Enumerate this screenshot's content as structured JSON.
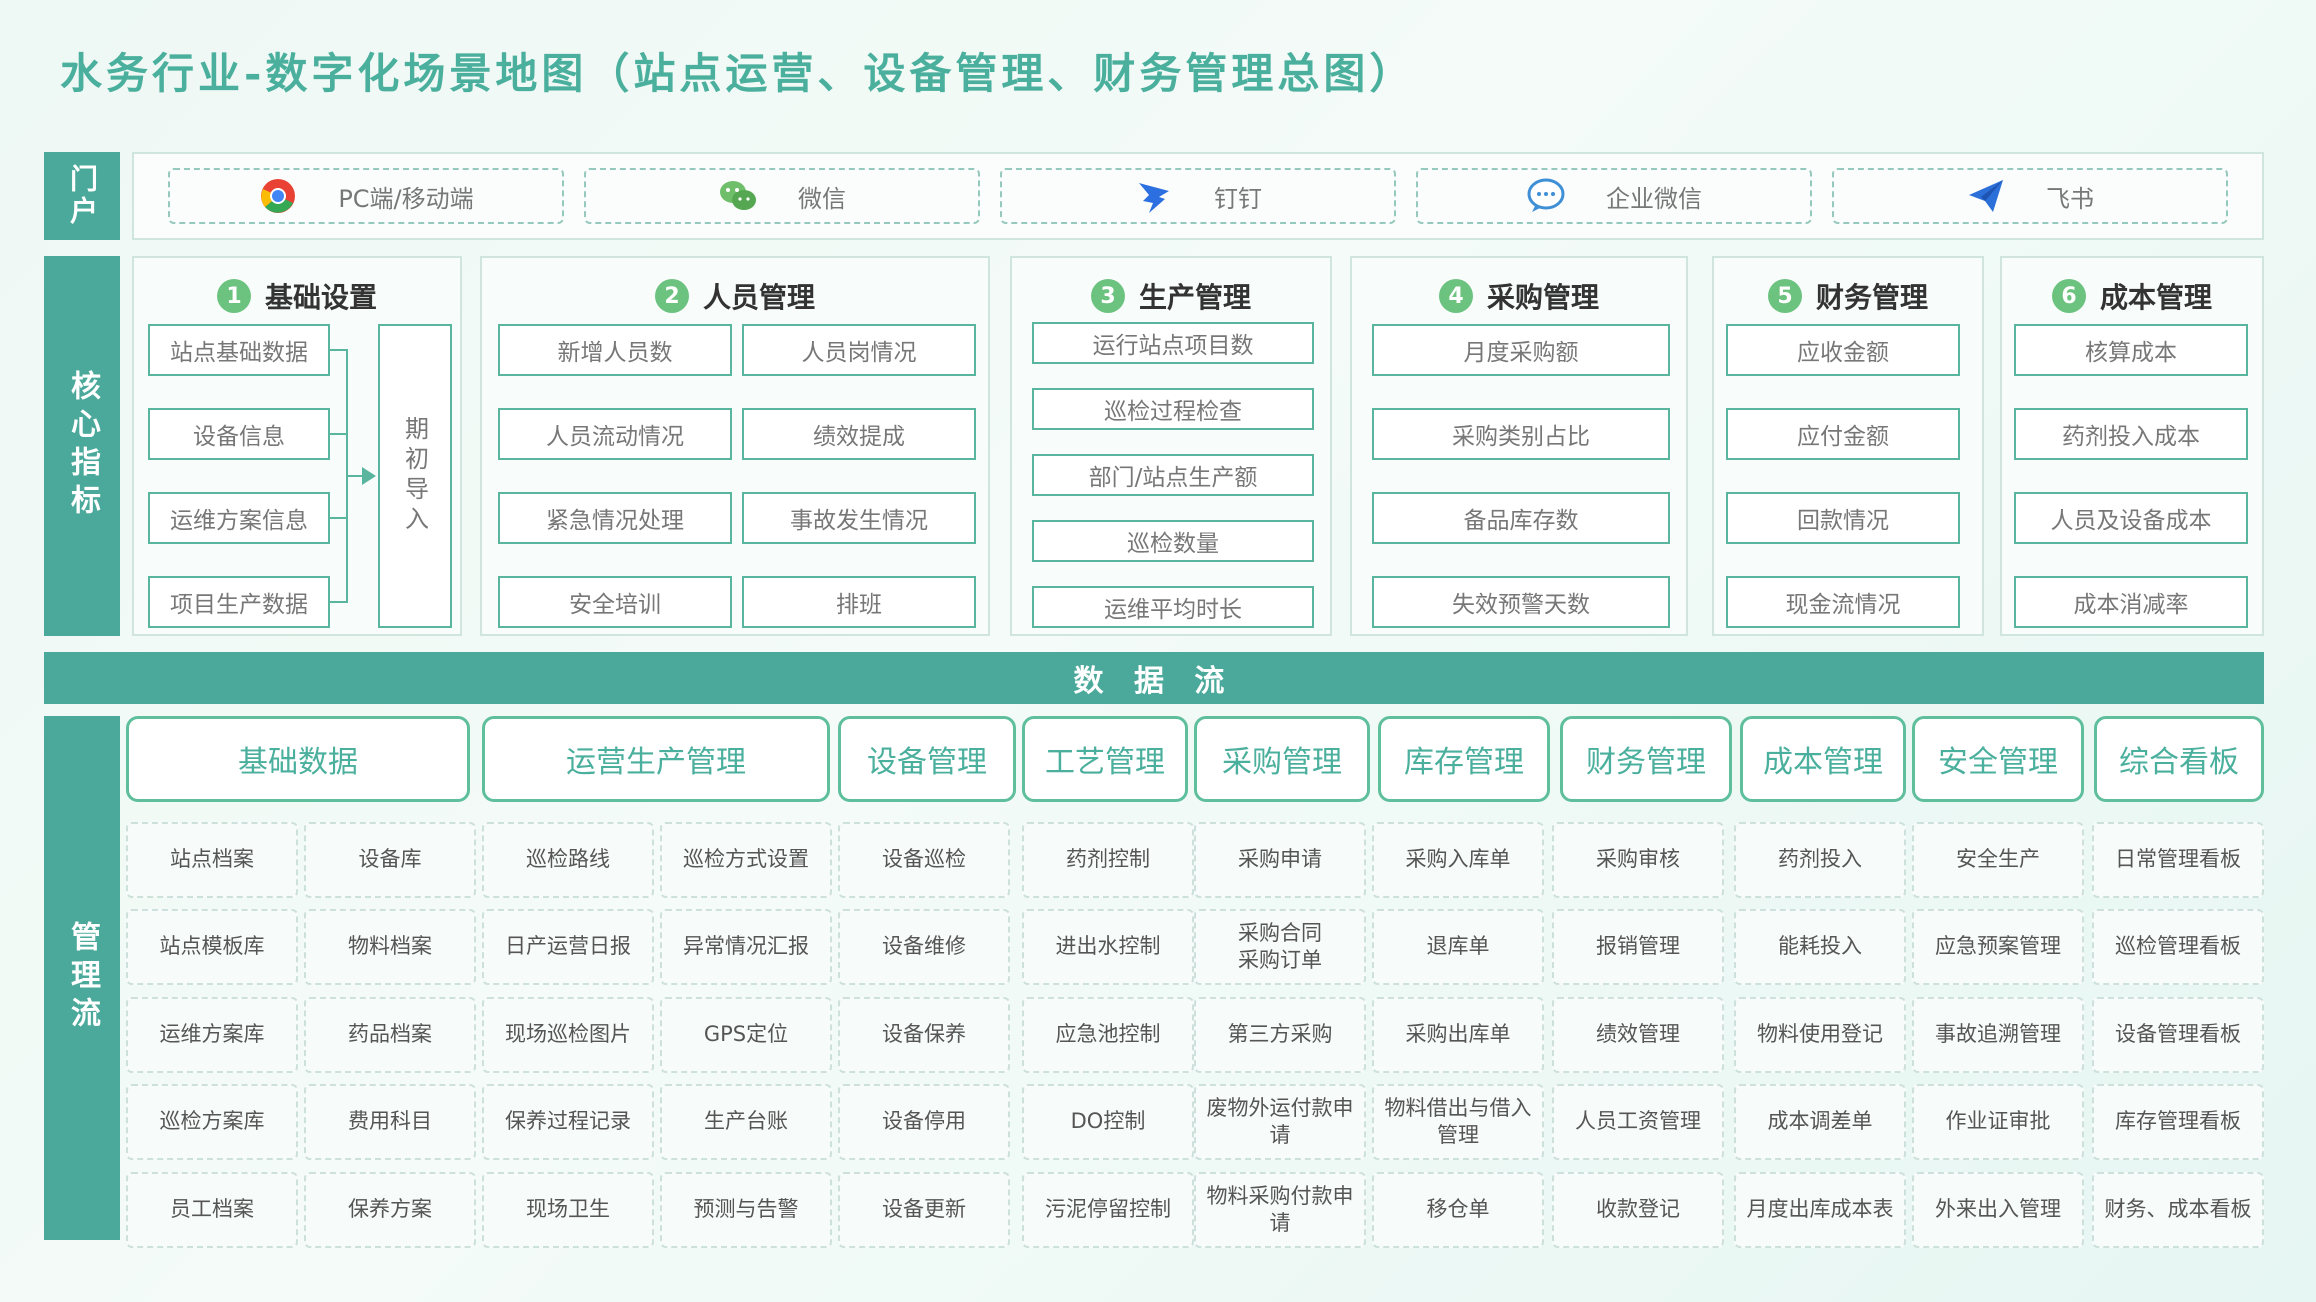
{
  "title": "水务行业-数字化场景地图（站点运营、设备管理、财务管理总图）",
  "side_labels": {
    "portal": "门户",
    "core": "核心指标",
    "mgmt": "管理流"
  },
  "portal": [
    {
      "label": "PC端/移动端",
      "icon": "chrome-icon"
    },
    {
      "label": "微信",
      "icon": "wechat-icon"
    },
    {
      "label": "钉钉",
      "icon": "dingtalk-icon"
    },
    {
      "label": "企业微信",
      "icon": "wecom-icon"
    },
    {
      "label": "飞书",
      "icon": "feishu-icon"
    }
  ],
  "core": [
    {
      "num": "1",
      "title": "基础设置",
      "items": [
        "站点基础数据",
        "设备信息",
        "运维方案信息",
        "项目生产数据"
      ],
      "target": "期初导入"
    },
    {
      "num": "2",
      "title": "人员管理",
      "items": [
        "新增人员数",
        "人员岗情况",
        "人员流动情况",
        "绩效提成",
        "紧急情况处理",
        "事故发生情况",
        "安全培训",
        "排班"
      ]
    },
    {
      "num": "3",
      "title": "生产管理",
      "items": [
        "运行站点项目数",
        "巡检过程检查",
        "部门/站点生产额",
        "巡检数量",
        "运维平均时长"
      ]
    },
    {
      "num": "4",
      "title": "采购管理",
      "items": [
        "月度采购额",
        "采购类别占比",
        "备品库存数",
        "失效预警天数"
      ]
    },
    {
      "num": "5",
      "title": "财务管理",
      "items": [
        "应收金额",
        "应付金额",
        "回款情况",
        "现金流情况"
      ]
    },
    {
      "num": "6",
      "title": "成本管理",
      "items": [
        "核算成本",
        "药剂投入成本",
        "人员及设备成本",
        "成本消减率"
      ]
    }
  ],
  "flow_label": "数 据 流",
  "headers": [
    "基础数据",
    "运营生产管理",
    "设备管理",
    "工艺管理",
    "采购管理",
    "库存管理",
    "财务管理",
    "成本管理",
    "安全管理",
    "综合看板"
  ],
  "grid": [
    [
      "站点档案",
      "设备库",
      "巡检路线",
      "巡检方式设置",
      "设备巡检",
      "药剂控制",
      "采购申请",
      "采购入库单",
      "采购审核",
      "药剂投入",
      "安全生产",
      "日常管理看板"
    ],
    [
      "站点模板库",
      "物料档案",
      "日产运营日报",
      "异常情况汇报",
      "设备维修",
      "进出水控制",
      "采购合同\n采购订单",
      "退库单",
      "报销管理",
      "能耗投入",
      "应急预案管理",
      "巡检管理看板"
    ],
    [
      "运维方案库",
      "药品档案",
      "现场巡检图片",
      "GPS定位",
      "设备保养",
      "应急池控制",
      "第三方采购",
      "采购出库单",
      "绩效管理",
      "物料使用登记",
      "事故追溯管理",
      "设备管理看板"
    ],
    [
      "巡检方案库",
      "费用科目",
      "保养过程记录",
      "生产台账",
      "设备停用",
      "DO控制",
      "废物外运付款申请",
      "物料借出与借入管理",
      "人员工资管理",
      "成本调差单",
      "作业证审批",
      "库存管理看板"
    ],
    [
      "员工档案",
      "保养方案",
      "现场卫生",
      "预测与告警",
      "设备更新",
      "污泥停留控制",
      "物料采购付款申请",
      "移仓单",
      "收款登记",
      "月度出库成本表",
      "外来出入管理",
      "财务、成本看板"
    ]
  ]
}
